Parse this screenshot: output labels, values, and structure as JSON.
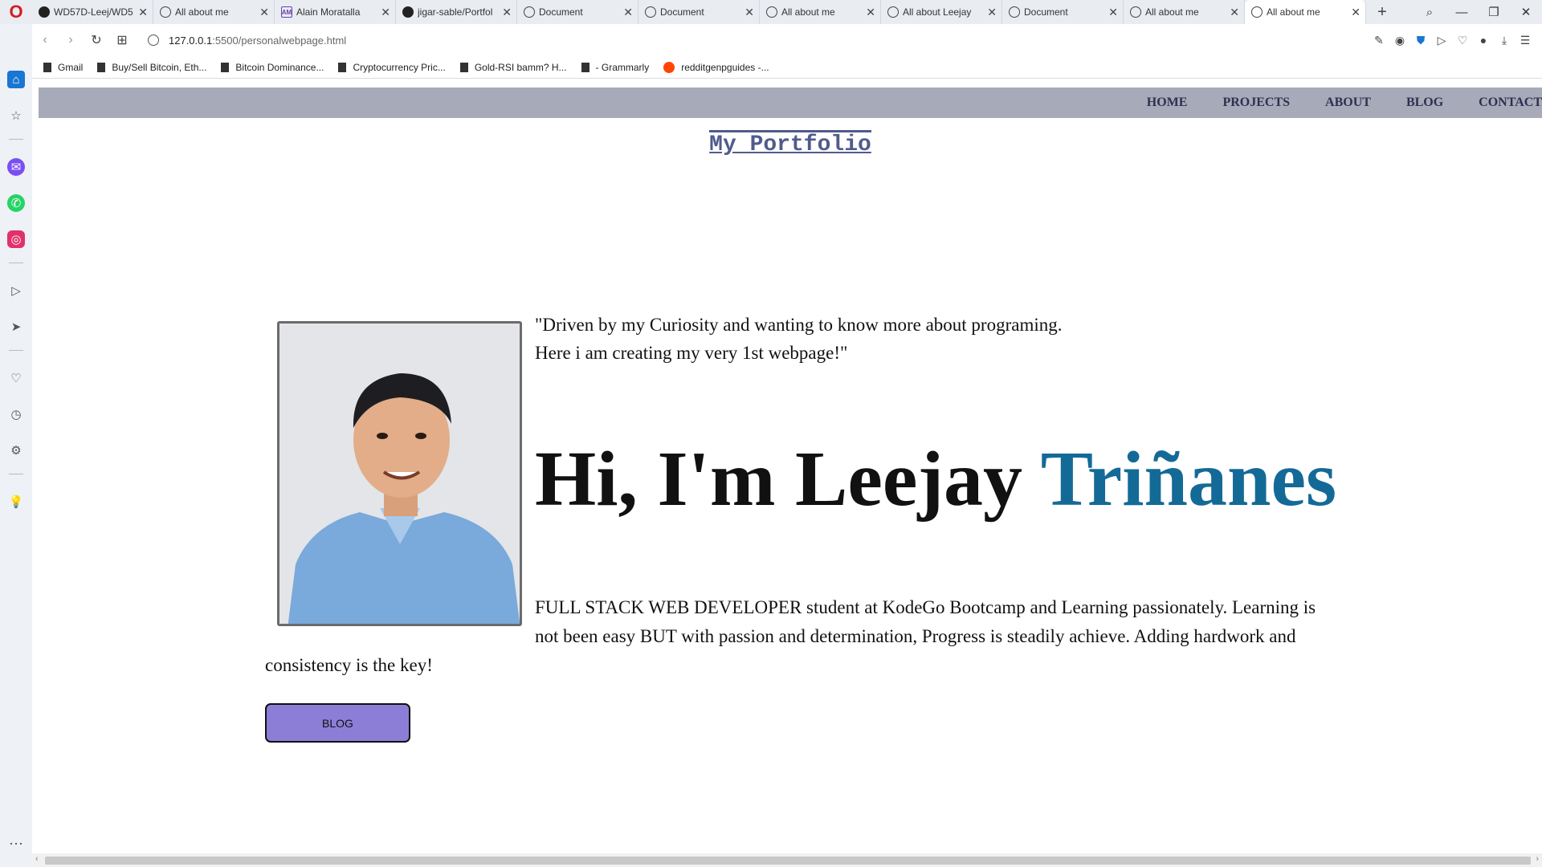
{
  "browser": {
    "tabs": [
      {
        "title": "WD57D-Leej/WD5",
        "icon": "github-icon"
      },
      {
        "title": "All about me",
        "icon": "globe-icon"
      },
      {
        "title": "Alain Moratalla",
        "icon": "am-logo-icon"
      },
      {
        "title": "jigar-sable/Portfol",
        "icon": "github-icon"
      },
      {
        "title": "Document",
        "icon": "globe-icon"
      },
      {
        "title": "Document",
        "icon": "globe-icon"
      },
      {
        "title": "All about me",
        "icon": "globe-icon"
      },
      {
        "title": "All about Leejay",
        "icon": "globe-icon"
      },
      {
        "title": "Document",
        "icon": "globe-icon"
      },
      {
        "title": "All about me",
        "icon": "globe-icon"
      },
      {
        "title": "All about me",
        "icon": "globe-icon",
        "active": true
      }
    ],
    "url_host": "127.0.0.1",
    "url_rest": ":5500/personalwebpage.html",
    "bookmarks": [
      {
        "label": "Gmail",
        "icon": "folder-icon"
      },
      {
        "label": "Buy/Sell Bitcoin, Eth...",
        "icon": "folder-icon"
      },
      {
        "label": "Bitcoin Dominance...",
        "icon": "folder-icon"
      },
      {
        "label": "Cryptocurrency Pric...",
        "icon": "folder-icon"
      },
      {
        "label": "Gold-RSI bamm? H...",
        "icon": "folder-icon"
      },
      {
        "label": "- Grammarly",
        "icon": "folder-icon"
      },
      {
        "label": "redditgenpguides -...",
        "icon": "reddit-icon"
      }
    ]
  },
  "site": {
    "nav": [
      "HOME",
      "PROJECTS",
      "ABOUT",
      "BLOG",
      "CONTACT"
    ],
    "portfolio_title": "My Portfolio",
    "quote_line1": "\"Driven by my Curiosity and wanting to know more about programing.",
    "quote_line2": "Here i am creating my very 1st webpage!\"",
    "headline_prefix": "Hi, I'm Leejay ",
    "headline_accent": "Triñanes",
    "bio_line1": "FULL STACK WEB DEVELOPER student at KodeGo Bootcamp and Learning passionately. Learning is",
    "bio_line2": "not been easy BUT with passion and determination, Progress is steadily achieve. Adding hardwork and",
    "bio_line3": "consistency is the key!",
    "blog_button": "BLOG"
  },
  "colors": {
    "navbar_bg": "#a7aab9",
    "accent": "#146a97",
    "button_bg": "#8c7ed6",
    "title_color": "#505b8c"
  }
}
